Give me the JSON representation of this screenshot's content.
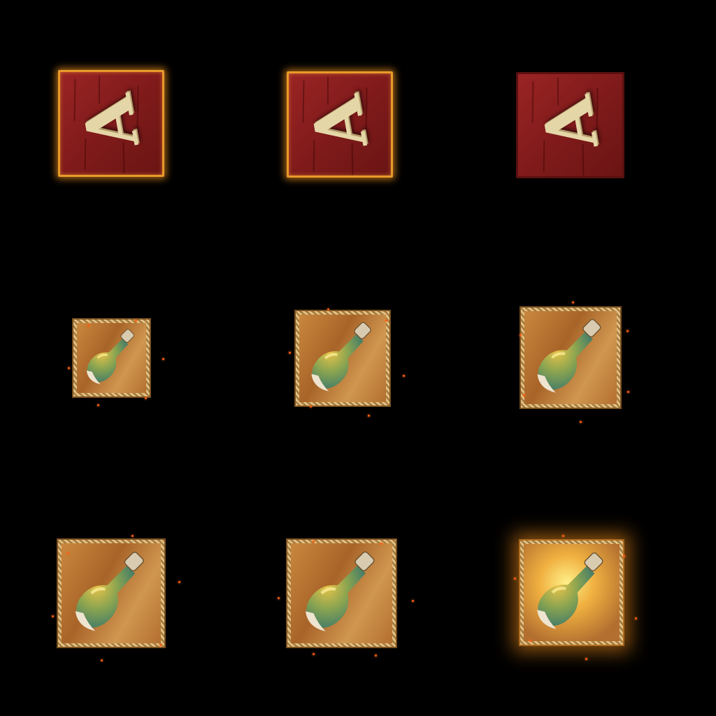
{
  "sprite_sheet": {
    "letter_glyph": "A",
    "colors": {
      "letter_bg": "#8a1f1f",
      "letter_face": "#e5d6a8",
      "glow": "#e89a2a",
      "wood": "#b8783a",
      "rope": "#d9b577",
      "bottle_green": "#6f9a5a",
      "ember": "#ff5a10"
    },
    "frames": [
      {
        "symbol": "letter-a",
        "glow": true
      },
      {
        "symbol": "letter-a",
        "glow": true
      },
      {
        "symbol": "letter-a",
        "glow": false
      },
      {
        "symbol": "potion-bottle",
        "glow": false
      },
      {
        "symbol": "potion-bottle",
        "glow": false
      },
      {
        "symbol": "potion-bottle",
        "glow": false
      },
      {
        "symbol": "potion-bottle",
        "glow": false
      },
      {
        "symbol": "potion-bottle",
        "glow": false
      },
      {
        "symbol": "potion-bottle",
        "glow": true
      }
    ]
  }
}
